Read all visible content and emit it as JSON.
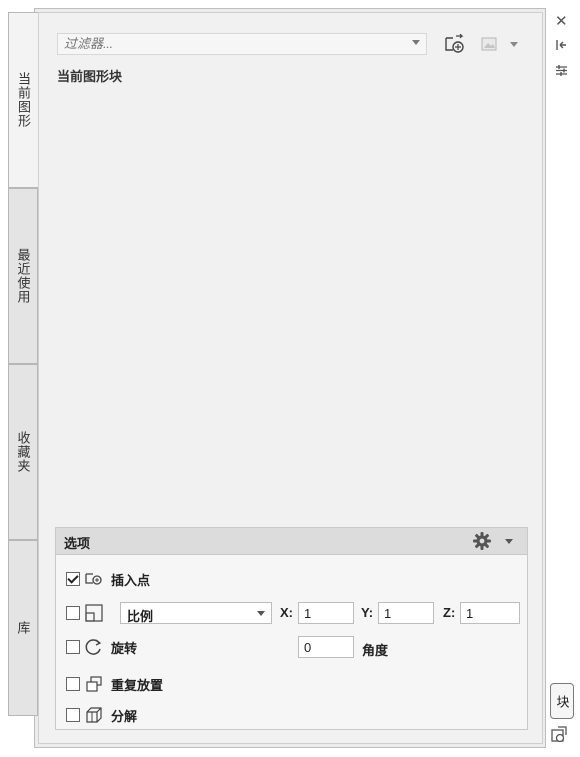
{
  "tabs": [
    {
      "label": "当前图形"
    },
    {
      "label": "最近使用"
    },
    {
      "label": "收藏夹"
    },
    {
      "label": "库"
    }
  ],
  "filter": {
    "placeholder": "过滤器..."
  },
  "section_title": "当前图形块",
  "right_strip": {
    "block_tab": "块"
  },
  "options": {
    "title": "选项",
    "insert_point": {
      "label": "插入点",
      "checked": true
    },
    "scale": {
      "label": "比例",
      "checked": false,
      "x_label": "X:",
      "x": "1",
      "y_label": "Y:",
      "y": "1",
      "z_label": "Z:",
      "z": "1"
    },
    "rotate": {
      "label": "旋转",
      "checked": false,
      "angle_value": "0",
      "angle_label": "角度"
    },
    "repeat": {
      "label": "重复放置",
      "checked": false
    },
    "explode": {
      "label": "分解",
      "checked": false
    }
  }
}
